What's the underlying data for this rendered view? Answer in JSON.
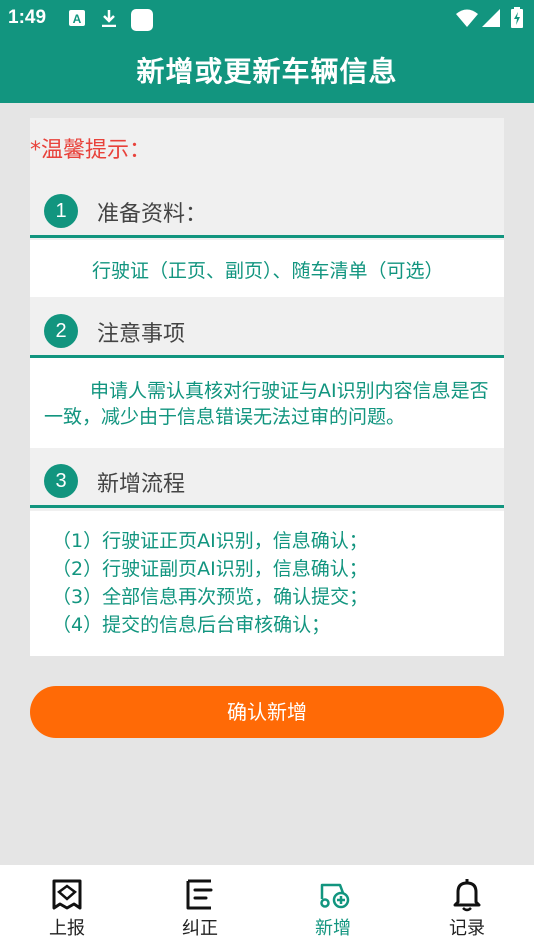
{
  "status_bar": {
    "time": "1:49"
  },
  "header": {
    "title": "新增或更新车辆信息"
  },
  "notice": "*温馨提示：",
  "sections": [
    {
      "num": "1",
      "title": "准备资料：",
      "body": "行驶证（正页、副页）、随车清单（可选）"
    },
    {
      "num": "2",
      "title": "注意事项",
      "body": "申请人需认真核对行驶证与AI识别内容信息是否一致，减少由于信息错误无法过审的问题。"
    },
    {
      "num": "3",
      "title": "新增流程",
      "steps": [
        "（1）行驶证正页AI识别，信息确认；",
        "（2）行驶证副页AI识别，信息确认；",
        "（3）全部信息再次预览，确认提交；",
        "（4）提交的信息后台审核确认；"
      ]
    }
  ],
  "confirm_button": "确认新增",
  "bottom_nav": [
    {
      "label": "上报",
      "icon": "report-icon",
      "active": false
    },
    {
      "label": "纠正",
      "icon": "correct-icon",
      "active": false
    },
    {
      "label": "新增",
      "icon": "add-vehicle-icon",
      "active": true
    },
    {
      "label": "记录",
      "icon": "bell-icon",
      "active": false
    }
  ],
  "colors": {
    "primary": "#12957f",
    "accent": "#ff6a06",
    "notice": "#e8423b"
  }
}
